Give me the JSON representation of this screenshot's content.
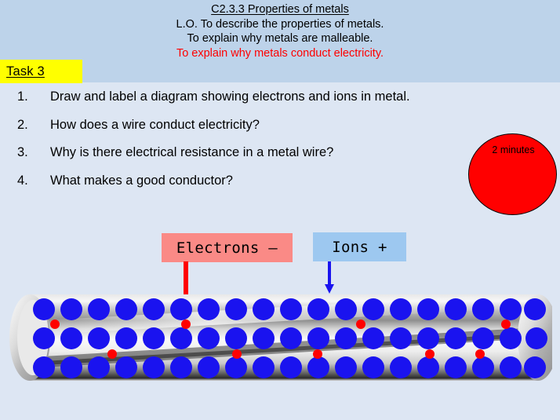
{
  "slide": {
    "header_bg": "#bdd3ea",
    "body_bg": "#dde6f3",
    "title_lines": [
      {
        "text": "C2.3.3 Properties of metals",
        "style": "underlined"
      },
      {
        "text": "L.O. To describe the properties of metals.",
        "style": "plain"
      },
      {
        "text": "To explain why metals are malleable.",
        "style": "plain"
      },
      {
        "text": "To explain why metals conduct electricity.",
        "style": "red"
      }
    ],
    "task_badge": {
      "label": "Task 3",
      "bg": "#ffff00"
    },
    "questions": [
      {
        "num": "1.",
        "text": "Draw and label a diagram showing electrons and ions in metal."
      },
      {
        "num": "2.",
        "text": "How does a wire conduct electricity?"
      },
      {
        "num": "3.",
        "text": "Why is there electrical resistance in a metal wire?"
      },
      {
        "num": "4.",
        "text": "What makes a good conductor?"
      }
    ],
    "timer": {
      "label": "2 minutes",
      "color": "#ff0000"
    },
    "callouts": {
      "electrons": {
        "label": "Electrons –",
        "bg": "#fa8a86",
        "arrow_color": "#ff0000"
      },
      "ions": {
        "label": "Ions +",
        "bg": "#9dc8f0",
        "arrow_color": "#1a13ef"
      }
    },
    "diagram": {
      "name": "metal-wire-cylinder",
      "ion_color": "#1a13ef",
      "electron_color": "#ff0000",
      "ion_rows": 3,
      "ions_per_row": 19,
      "electron_count": 9
    }
  }
}
